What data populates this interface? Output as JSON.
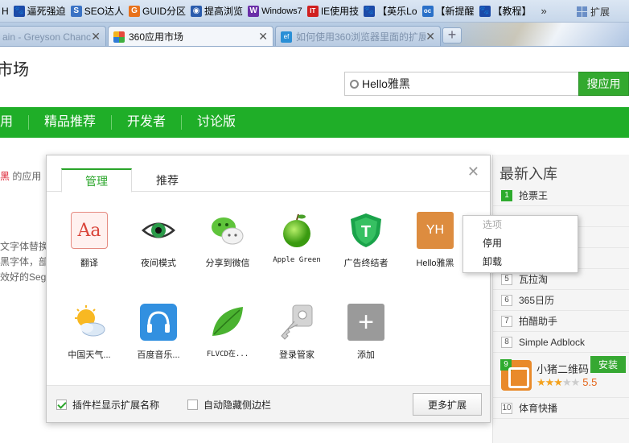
{
  "bookmarks": [
    {
      "label": "H",
      "icon": "",
      "color": "#2b6bd6"
    },
    {
      "label": "逼死强迫",
      "icon": "🐾",
      "color": "#1c4aa8"
    },
    {
      "label": "SEO达人",
      "icon": "S",
      "color": "#3a72c4"
    },
    {
      "label": "GUID分区",
      "icon": "G",
      "color": "#e8721c"
    },
    {
      "label": "提高浏览",
      "icon": "◉",
      "color": "#2a5cad"
    },
    {
      "label": "Windows7",
      "icon": "W",
      "color": "#6a2fa8"
    },
    {
      "label": "IE使用技",
      "icon": "IT",
      "color": "#d02020"
    },
    {
      "label": "【英乐Lo",
      "icon": "🐾",
      "color": "#1c4aa8"
    },
    {
      "label": "【新提醒",
      "icon": "oc",
      "color": "#2a70c8"
    },
    {
      "label": "【教程】",
      "icon": "🐾",
      "color": "#1c4aa8"
    }
  ],
  "bookmarks_more": "»",
  "extensions_label": "扩展",
  "tabs": [
    {
      "label": "ain - Greyson Chanc",
      "state": "inactive",
      "close": "✕"
    },
    {
      "label": "360应用市场",
      "state": "active",
      "close": "✕"
    },
    {
      "label": "如何使用360浏览器里面的扩展",
      "state": "inactive",
      "close": "✕"
    }
  ],
  "new_tab": "+",
  "page": {
    "title": "市场",
    "search_value": "Hello雅黑",
    "search_button": "搜应用",
    "nav": [
      "用",
      "精品推荐",
      "开发者",
      "讨论版"
    ]
  },
  "background_text": {
    "line1_red": "黑",
    "line1_rest": " 的应用",
    "line2": "文字体替换为",
    "line3": "黑字体，部分",
    "line4": "效好的Sego"
  },
  "right_panel": {
    "title": "最新入库",
    "items": [
      {
        "num": "1",
        "name": "抢票王"
      },
      {
        "num": "5",
        "name": "瓦拉淘"
      },
      {
        "num": "6",
        "name": "365日历"
      },
      {
        "num": "7",
        "name": "拍醋助手"
      },
      {
        "num": "8",
        "name": "Simple Adblock"
      }
    ],
    "featured": {
      "num": "9",
      "name": "小猪二维码",
      "install": "安装",
      "stars_on": "★★★",
      "stars_off": "★★",
      "score": "5.5"
    },
    "last": {
      "num": "10",
      "name": "体育快播"
    }
  },
  "modal": {
    "tab_manage": "管理",
    "tab_recommend": "推荐",
    "close": "✕",
    "apps_row1": [
      {
        "name": "翻译",
        "icon": "translate-icon",
        "glyph": "Aa"
      },
      {
        "name": "夜间模式",
        "icon": "eye-icon"
      },
      {
        "name": "分享到微信",
        "icon": "wechat-icon"
      },
      {
        "name": "Apple Green",
        "icon": "apple-icon"
      },
      {
        "name": "广告终结者",
        "icon": "shield-icon",
        "glyph": "T"
      },
      {
        "name": "Hello雅黑",
        "icon": "yh-icon",
        "glyph": "YH"
      }
    ],
    "apps_row2": [
      {
        "name": "中国天气...",
        "icon": "weather-icon"
      },
      {
        "name": "百度音乐...",
        "icon": "headphones-icon"
      },
      {
        "name": "FLVCD在...",
        "icon": "leaf-icon"
      },
      {
        "name": "登录管家",
        "icon": "key-icon"
      },
      {
        "name": "添加",
        "icon": "add-icon",
        "glyph": "+"
      }
    ],
    "footer": {
      "show_names": "插件栏显示扩展名称",
      "auto_hide": "自动隐藏侧边栏",
      "more": "更多扩展"
    }
  },
  "context_menu": {
    "items": [
      "选项",
      "停用",
      "卸载"
    ]
  }
}
